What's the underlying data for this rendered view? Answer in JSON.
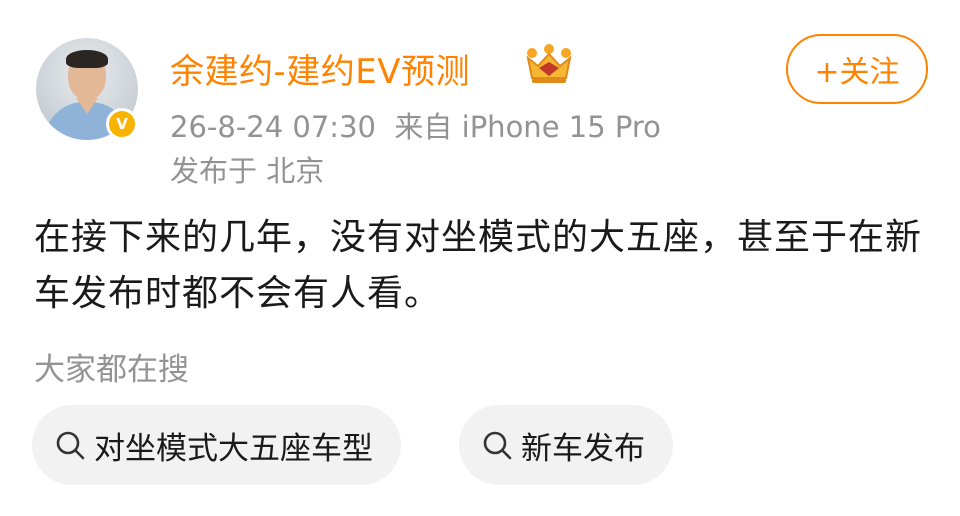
{
  "post": {
    "author": {
      "name": "余建约-建约EV预测",
      "verified_badge": "V",
      "badge_icon": "crown-icon"
    },
    "timestamp": "26-8-24 07:30",
    "source": "来自 iPhone 15 Pro",
    "location": "发布于 北京",
    "follow_label": "+关注",
    "text": "在接下来的几年，没有对坐模式的大五座，甚至于在新车发布时都不会有人看。"
  },
  "search": {
    "label": "大家都在搜",
    "chips": [
      {
        "label": "对坐模式大五座车型",
        "icon": "search-icon"
      },
      {
        "label": "新车发布",
        "icon": "search-icon"
      }
    ]
  },
  "colors": {
    "accent": "#ff8200",
    "meta_text": "#939393",
    "body_text": "#1a1a1a",
    "chip_bg": "#f2f2f2",
    "verified": "#f8b400"
  }
}
